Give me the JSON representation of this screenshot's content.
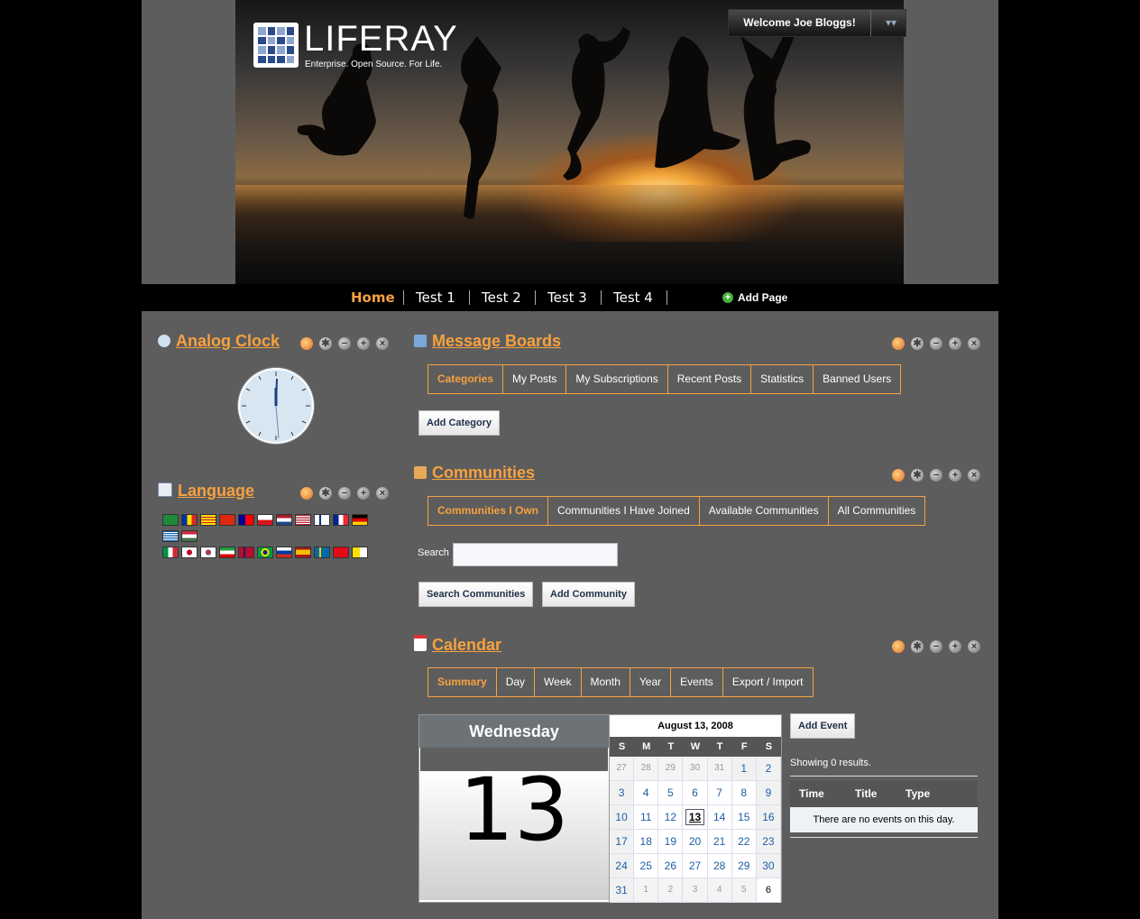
{
  "header": {
    "logo_text": "LIFERAY",
    "logo_tagline": "Enterprise. Open Source. For Life.",
    "welcome": "Welcome Joe Bloggs!"
  },
  "nav": {
    "items": [
      {
        "label": "Home",
        "active": true
      },
      {
        "label": "Test 1"
      },
      {
        "label": "Test 2"
      },
      {
        "label": "Test 3"
      },
      {
        "label": "Test 4"
      }
    ],
    "add_page": "Add Page"
  },
  "portlets": {
    "clock": {
      "title": "Analog Clock"
    },
    "language": {
      "title": "Language",
      "flags": [
        "ar",
        "ca",
        "ca-ad",
        "zh-cn",
        "zh-tw",
        "cs",
        "nl",
        "en",
        "fi",
        "fr",
        "de",
        "el",
        "hu",
        "it",
        "ja",
        "ko",
        "fa",
        "no",
        "pt-br",
        "ru",
        "es",
        "sv",
        "tr",
        "vi"
      ]
    },
    "message_boards": {
      "title": "Message Boards",
      "tabs": [
        "Categories",
        "My Posts",
        "My Subscriptions",
        "Recent Posts",
        "Statistics",
        "Banned Users"
      ],
      "add_category": "Add Category"
    },
    "communities": {
      "title": "Communities",
      "tabs": [
        "Communities I Own",
        "Communities I Have Joined",
        "Available Communities",
        "All Communities"
      ],
      "search_label": "Search",
      "search_value": "",
      "search_button": "Search Communities",
      "add_button": "Add Community"
    },
    "calendar": {
      "title": "Calendar",
      "tabs": [
        "Summary",
        "Day",
        "Week",
        "Month",
        "Year",
        "Events",
        "Export / Import"
      ],
      "weekday": "Wednesday",
      "day_number": "13",
      "month_title": "August 13, 2008",
      "week_headers": [
        "S",
        "M",
        "T",
        "W",
        "T",
        "F",
        "S"
      ],
      "add_event": "Add Event",
      "results_text": "Showing 0 results.",
      "columns": [
        "Time",
        "Title",
        "Type"
      ],
      "empty_text": "There are no events on this day."
    }
  }
}
